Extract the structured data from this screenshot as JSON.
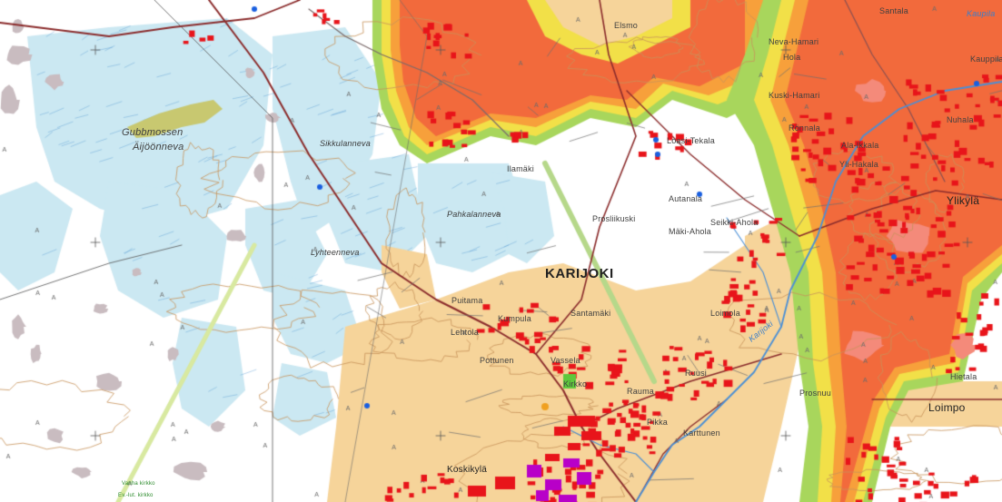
{
  "map": {
    "colors": {
      "background": "#ffffff",
      "bog": "#cbe8f2",
      "field": "#f6d49a",
      "rock": "#c9bcc0",
      "forest_dark": "#a9a9a9",
      "road_major": "#8b2c2c",
      "road_minor": "#6e6e6e",
      "river": "#4a8fd6",
      "building": "#e8141a",
      "public_building": "#b800c8",
      "zone_red": "#f26a3c",
      "zone_orange": "#f7a03b",
      "zone_yellow": "#f2e048",
      "zone_green": "#a8d65c",
      "contour": "#c8935a"
    },
    "labels": {
      "town_karijoki": "KARIJOKI",
      "village_ylikyla": "Ylikylä",
      "village_loimpo": "Loimpo",
      "village_koskikyla": "Koskikylä",
      "bog_gubbmossen": "Gubbmossen",
      "bog_aijoonneva": "Äijöönneva",
      "bog_pahkalanneva": "Pahkalanneva",
      "bog_sikkulanneva": "Sikkulanneva",
      "bog_lyhteenneva": "Lyhteenneva",
      "place_elsmo": "Elsmo",
      "place_nevahamari": "Neva-Hamari",
      "place_kuskihamari": "Kuski-Hamari",
      "place_kaupila": "Kauppila",
      "place_santala": "Santala",
      "place_ilamaki": "Ilamäki",
      "place_proslikuski": "Prosliikuski",
      "place_loasitekala": "Loasi-Tekala",
      "place_autanala": "Autanala",
      "place_seikkahola": "Seikki-Ahola",
      "place_maki_ahola": "Mäki-Ahola",
      "place_rujo": "Ruijo",
      "place_kumpula": "Kumpula",
      "place_lehtola": "Lehtola",
      "place_puitama": "Puitama",
      "place_pottunen": "Pottunen",
      "place_santamaki": "Santamäki",
      "place_vassela": "Vassela",
      "place_ruusi": "Ruusi",
      "place_loimola": "Loimola",
      "place_prosnuu": "Prosnuu",
      "place_hietala": "Hietala",
      "place_kirkko": "Kirkko",
      "place_ala_ikkala": "Ala-Ikkala",
      "place_nuhala": "Nuhala",
      "place_yli_hakala": "Yli-Hakala",
      "place_ronnala": "Rönnala",
      "place_pikka": "Pikka",
      "place_karttunen": "Karttunen",
      "place_hola": "Hola",
      "place_rauma": "Rauma",
      "water_kaupila": "Kaupila",
      "river_karijoki": "Karijoki",
      "green_note_1": "Vanha kirkko",
      "green_note_2": "Ev.-lut. kirkko"
    }
  }
}
